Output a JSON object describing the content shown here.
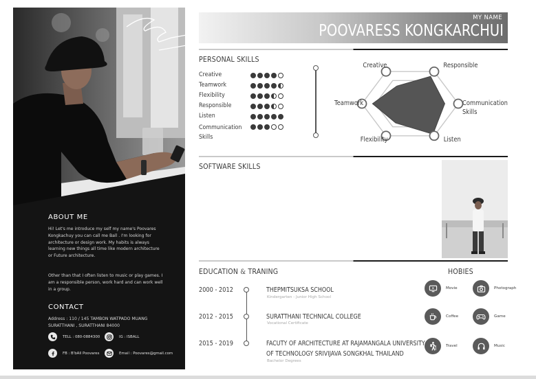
{
  "header": {
    "my_name_label": "MY NAME",
    "full_name": "POOVARESS KONGKARCHUI"
  },
  "about": {
    "title": "ABOUT ME",
    "paragraph1": "Hi! Let's me introduce my self my name's Poovares\nKongkachuy you can call me Ball . I'm looking for\narchitecture or design work. My habits is always\nlearning new things all time like modern architecture\nor Future architecture.",
    "paragraph2": "Other than that I often listen to music or play games. I\nam a responsible person, work hard and can work well\nin a group."
  },
  "contact": {
    "title": "CONTACT",
    "address": "Address : 110 / 145 TAMBON WATPADO MUANG\nSURATTHANI , SURATTHANI 84000",
    "tel": "TELL : 080-0884300",
    "ig": "IG : ISBALL",
    "fb": "FB : B'bAll Poovares",
    "email": "Email : Poovares@gmail.com",
    "icons": [
      "phone-icon",
      "instagram-icon",
      "facebook-icon",
      "email-icon"
    ]
  },
  "personal_skills": {
    "title": "PERSONAL SKILLS",
    "items": [
      {
        "name": "Creative",
        "level": 4
      },
      {
        "name": "Teamwork",
        "level": 4.5
      },
      {
        "name": "Flexibility",
        "level": 3.5
      },
      {
        "name": "Responsible",
        "level": 3.5
      },
      {
        "name": "Listen",
        "level": 5
      },
      {
        "name": "Communication\nSkills",
        "level": 3
      }
    ]
  },
  "radar": {
    "labels": {
      "creative": "Creative",
      "responsible": "Responsible",
      "teamwork": "Teamwork",
      "communication": "Communication\nSkills",
      "flexibility": "Flexibility",
      "listen": "Listen"
    },
    "values": {
      "creative": 0.55,
      "responsible": 0.85,
      "communication": 0.72,
      "listen": 0.95,
      "flexibility": 0.6,
      "teamwork": 0.78
    },
    "fill_color": "#555555"
  },
  "software_skills": {
    "title": "SOFTWARE SKILLS"
  },
  "education": {
    "title_part1": "EDUCATION",
    "title_amp": "&",
    "title_part2": "TRANING",
    "entries": [
      {
        "years": "2000 - 2012",
        "school": "THEPMITSUKSA SCHOOL",
        "note": "Kindergarten - Junior High School"
      },
      {
        "years": "2012 - 2015",
        "school": "SURATTHANI TECHNICAL COLLEGE",
        "note": "Vocational Certificate"
      },
      {
        "years": "2015 - 2019",
        "school": "FACUTY OF ARCHITECTURE AT  RAJAMANGALA UNIVERSITY",
        "school2": "OF TECHNOLOGY SRIVIJAVA SONGKHAL THAILAND",
        "note": "Bachelor Degrees"
      }
    ]
  },
  "hobbies": {
    "title": "HOBIES",
    "items": [
      {
        "label": "Movie",
        "icon": "monitor-icon"
      },
      {
        "label": "Photograph",
        "icon": "camera-icon"
      },
      {
        "label": "Coffee",
        "icon": "coffee-icon"
      },
      {
        "label": "Game",
        "icon": "gamepad-icon"
      },
      {
        "label": "Travel",
        "icon": "hiker-icon"
      },
      {
        "label": "Music",
        "icon": "headphones-icon"
      }
    ]
  },
  "colors": {
    "dark_panel": "#141414",
    "accent_dark": "#3a3a3a",
    "icon_bg": "#5a5a5a"
  }
}
